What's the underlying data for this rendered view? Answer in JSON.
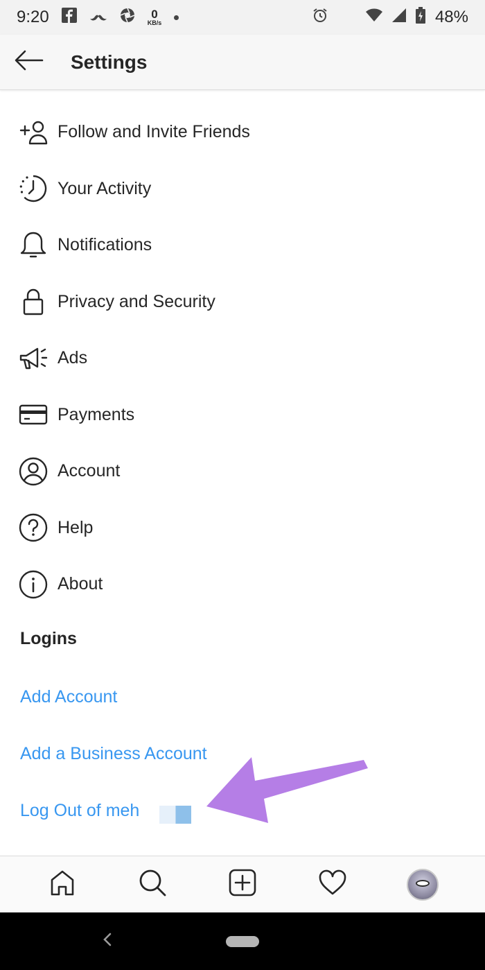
{
  "status_bar": {
    "time": "9:20",
    "network_speed_value": "0",
    "network_speed_unit": "KB/s",
    "battery": "48%",
    "icons": [
      "facebook-icon",
      "mustache-icon",
      "aperture-icon",
      "alarm-icon",
      "wifi-icon",
      "signal-icon",
      "battery-icon"
    ]
  },
  "header": {
    "title": "Settings"
  },
  "menu": {
    "items": [
      {
        "label": "Follow and Invite Friends",
        "icon": "add-person-icon"
      },
      {
        "label": "Your Activity",
        "icon": "activity-clock-icon"
      },
      {
        "label": "Notifications",
        "icon": "bell-icon"
      },
      {
        "label": "Privacy and Security",
        "icon": "lock-icon"
      },
      {
        "label": "Ads",
        "icon": "megaphone-icon"
      },
      {
        "label": "Payments",
        "icon": "credit-card-icon"
      },
      {
        "label": "Account",
        "icon": "user-circle-icon"
      },
      {
        "label": "Help",
        "icon": "question-circle-icon"
      },
      {
        "label": "About",
        "icon": "info-circle-icon"
      }
    ]
  },
  "logins": {
    "title": "Logins",
    "add_account": "Add Account",
    "add_business": "Add a Business Account",
    "log_out": "Log Out of meh"
  },
  "annotation": {
    "arrow_color": "#b57ee6"
  },
  "tab_bar": {
    "tabs": [
      "home-icon",
      "search-icon",
      "add-post-icon",
      "heart-icon",
      "profile-avatar"
    ]
  },
  "colors": {
    "link": "#3897f0",
    "text": "#262626"
  }
}
